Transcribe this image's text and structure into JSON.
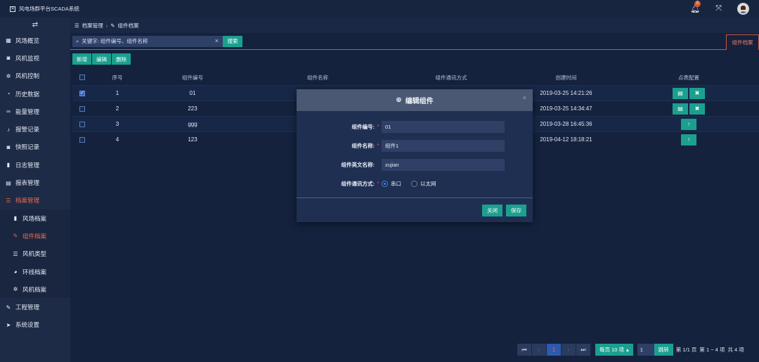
{
  "header": {
    "app_title": "风电场群平台SCADA系统",
    "notification_count": "0"
  },
  "sidebar": {
    "items": [
      {
        "label": "风场概览",
        "icon": "grid-icon"
      },
      {
        "label": "风机监视",
        "icon": "camera-icon"
      },
      {
        "label": "风机控制",
        "icon": "gear-icon"
      },
      {
        "label": "历史数据",
        "icon": "pie-icon"
      },
      {
        "label": "能量管理",
        "icon": "link-icon"
      },
      {
        "label": "报警记录",
        "icon": "bell-icon"
      },
      {
        "label": "快照记录",
        "icon": "camera-icon"
      },
      {
        "label": "日志管理",
        "icon": "file-icon"
      },
      {
        "label": "报表管理",
        "icon": "table-icon"
      },
      {
        "label": "档案管理",
        "icon": "list-icon"
      }
    ],
    "sub_items": [
      {
        "label": "风场档案",
        "icon": "bookmark-icon"
      },
      {
        "label": "组件档案",
        "icon": "wrench-icon"
      },
      {
        "label": "风机类型",
        "icon": "list-icon"
      },
      {
        "label": "环线档案",
        "icon": "globe-icon"
      },
      {
        "label": "风机档案",
        "icon": "gear-icon"
      }
    ],
    "bottom_items": [
      {
        "label": "工程管理",
        "icon": "wrench-icon"
      },
      {
        "label": "系统设置",
        "icon": "send-icon"
      }
    ]
  },
  "breadcrumb": {
    "parent": "档案管理",
    "separator": "›",
    "current": "组件档案"
  },
  "search": {
    "placeholder": "关键字: 组件编号、组件名称",
    "button": "搜索"
  },
  "tab": {
    "label": "组件档案"
  },
  "toolbar": {
    "add": "新增",
    "edit": "编辑",
    "delete": "删除"
  },
  "table": {
    "headers": {
      "no": "序号",
      "code": "组件编号",
      "name": "组件名称",
      "comm": "组件通讯方式",
      "time": "创建时间",
      "conf": "点表配置"
    },
    "rows": [
      {
        "no": "1",
        "code": "01",
        "time": "2019-03-25 14:21:26",
        "checked": true
      },
      {
        "no": "2",
        "code": "223",
        "time": "2019-03-25 14:34:47",
        "checked": false
      },
      {
        "no": "3",
        "code": "ggg",
        "time": "2019-03-28 16:45:36",
        "checked": false
      },
      {
        "no": "4",
        "code": "123",
        "time": "2019-04-12 18:18:21",
        "checked": false
      }
    ]
  },
  "modal": {
    "title": "编辑组件",
    "fields": {
      "code_label": "组件编号:",
      "code_value": "01",
      "name_label": "组件名称:",
      "name_value": "组件1",
      "en_label": "组件英文名称:",
      "en_value": "zujian",
      "comm_label": "组件通讯方式:",
      "option_serial": "串口",
      "option_ethernet": "以太网"
    },
    "close_button": "关闭",
    "save_button": "保存"
  },
  "pagination": {
    "current_page": "1",
    "per_page": "每页 10 项",
    "page_input": "1",
    "jump": "跳转",
    "info_pages": "第 1/1 页",
    "info_items": "第 1 ~ 4 项",
    "info_total": "共 4 项"
  },
  "colors": {
    "accent": "#1ba08f",
    "active": "#e86a4e",
    "background": "#14223e",
    "sidebar": "#1d2b47"
  }
}
